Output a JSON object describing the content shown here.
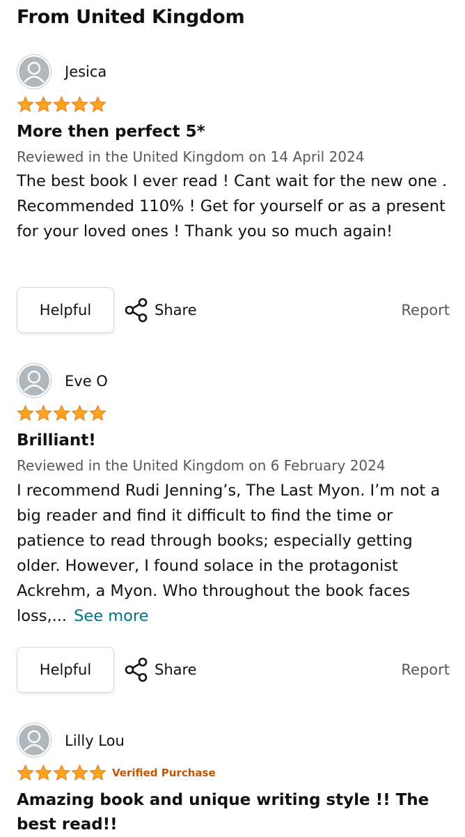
{
  "section_title": "From United Kingdom",
  "colors": {
    "star": "#ffa41c",
    "star_outline": "#de7921",
    "verified": "#c45500",
    "link": "#007185",
    "meta": "#565959",
    "avatar": "#b1b8bd"
  },
  "icons": {
    "avatar": "person-silhouette-icon",
    "star": "star-icon",
    "share": "share-icon"
  },
  "reviews": [
    {
      "reviewer": "Jesica",
      "rating": 5,
      "verified_label": "",
      "title": "More then perfect 5*",
      "meta": "Reviewed in the United Kingdom on 14 April 2024",
      "body": "The best book I ever read ! Cant wait for the new one . Recommended 110% ! Get for yourself or as a present for your loved ones ! Thank you so much again!",
      "see_more": "",
      "helpful_label": "Helpful",
      "share_label": "Share",
      "report_label": "Report"
    },
    {
      "reviewer": "Eve O",
      "rating": 5,
      "verified_label": "",
      "title": "Brilliant!",
      "meta": "Reviewed in the United Kingdom on 6 February 2024",
      "body": "I recommend Rudi Jenning’s, The Last Myon. I’m not a big reader and find it difficult to find the time or patience to read through books; especially getting older. However, I found solace in the protagonist Ackrehm, a Myon. Who throughout the book faces loss,...",
      "see_more": "See more",
      "helpful_label": "Helpful",
      "share_label": "Share",
      "report_label": "Report"
    },
    {
      "reviewer": "Lilly Lou",
      "rating": 5,
      "verified_label": "Verified Purchase",
      "title": "Amazing book and unique writing style !! The best read!!"
    }
  ]
}
